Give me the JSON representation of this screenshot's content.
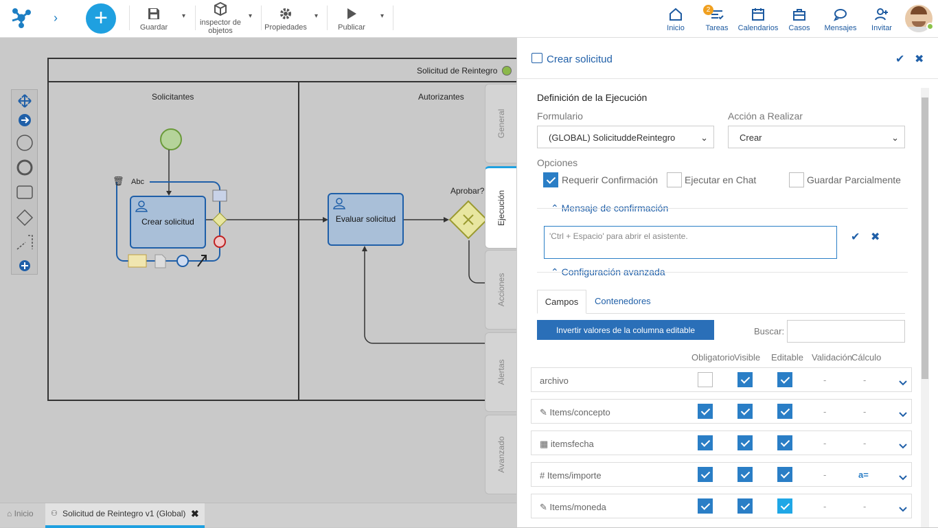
{
  "toolbar": {
    "save": "Guardar",
    "inspector": "inspector de objetos",
    "properties": "Propiedades",
    "publish": "Publicar"
  },
  "nav": {
    "home": "Inicio",
    "tasks": "Tareas",
    "tasks_badge": "2",
    "calendars": "Calendarios",
    "cases": "Casos",
    "messages": "Mensajes",
    "invite": "Invitar"
  },
  "diagram": {
    "pool_title": "Solicitud de Reintegro",
    "lane1": "Solicitantes",
    "lane2": "Autorizantes",
    "task1": "Crear solicitud",
    "task2": "Evaluar solicitud",
    "gateway": "Aprobar?",
    "edit_label": "Abc"
  },
  "side_tabs": [
    "General",
    "Ejecución",
    "Acciones",
    "Alertas",
    "Avanzado"
  ],
  "bottom": {
    "home": "Inicio",
    "tab": "Solicitud de Reintegro v1 (Global)"
  },
  "panel": {
    "title": "Crear solicitud",
    "section": "Definición de la Ejecución",
    "form_label": "Formulario",
    "form_value": "(GLOBAL) SolicituddeReintegro",
    "action_label": "Acción a Realizar",
    "action_value": "Crear",
    "options_label": "Opciones",
    "opt1": "Requerir Confirmación",
    "opt2": "Ejecutar en Chat",
    "opt3": "Guardar Parcialmente",
    "confirm_header": "Mensaje de confirmación",
    "textarea_placeholder": "'Ctrl + Espacio' para abrir el asistente.",
    "advanced_header": "Configuración avanzada",
    "tab_fields": "Campos",
    "tab_containers": "Contenedores",
    "invert_button": "Invertir valores de la columna editable",
    "search_label": "Buscar:",
    "columns": [
      "Obligatorio",
      "Visible",
      "Editable",
      "Validación",
      "Cálculo"
    ],
    "rows": [
      {
        "icon": "",
        "name": "archivo",
        "req": false,
        "vis": true,
        "edit": true,
        "val": "-",
        "calc": "-"
      },
      {
        "icon": "✎",
        "name": "Items/concepto",
        "req": true,
        "vis": true,
        "edit": true,
        "val": "-",
        "calc": "-"
      },
      {
        "icon": "▦",
        "name": "itemsfecha",
        "req": true,
        "vis": true,
        "edit": true,
        "val": "-",
        "calc": "-"
      },
      {
        "icon": "#",
        "name": "Items/importe",
        "req": true,
        "vis": true,
        "edit": true,
        "val": "-",
        "calc": "a="
      },
      {
        "icon": "✎",
        "name": "Items/moneda",
        "req": true,
        "vis": true,
        "edit": true,
        "val": "-",
        "calc": "-"
      }
    ]
  },
  "colors": {
    "accent": "#2a7ec6",
    "brand": "#1fa0e0"
  }
}
